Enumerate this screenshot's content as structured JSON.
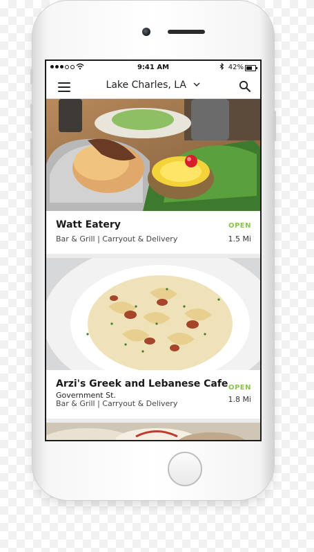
{
  "status_bar": {
    "time": "9:41 AM",
    "battery": "42%"
  },
  "header": {
    "location": "Lake Charles, LA"
  },
  "restaurants": [
    {
      "name": "Watt Eatery",
      "subtitle": "",
      "categories": "Bar & Grill | Carryout & Delivery",
      "status": "OPEN",
      "distance": "1.5 Mi"
    },
    {
      "name": "Arzi's Greek and Lebanese Cafe",
      "subtitle": "Government St.",
      "categories": "Bar & Grill | Carryout & Delivery",
      "status": "OPEN",
      "distance": "1.8 Mi"
    }
  ],
  "colors": {
    "open_status": "#8bc34a",
    "text_primary": "#1a1a1a"
  },
  "icons": [
    "menu-icon",
    "chevron-down-icon",
    "search-icon",
    "wifi-icon",
    "bluetooth-icon",
    "battery-icon"
  ]
}
